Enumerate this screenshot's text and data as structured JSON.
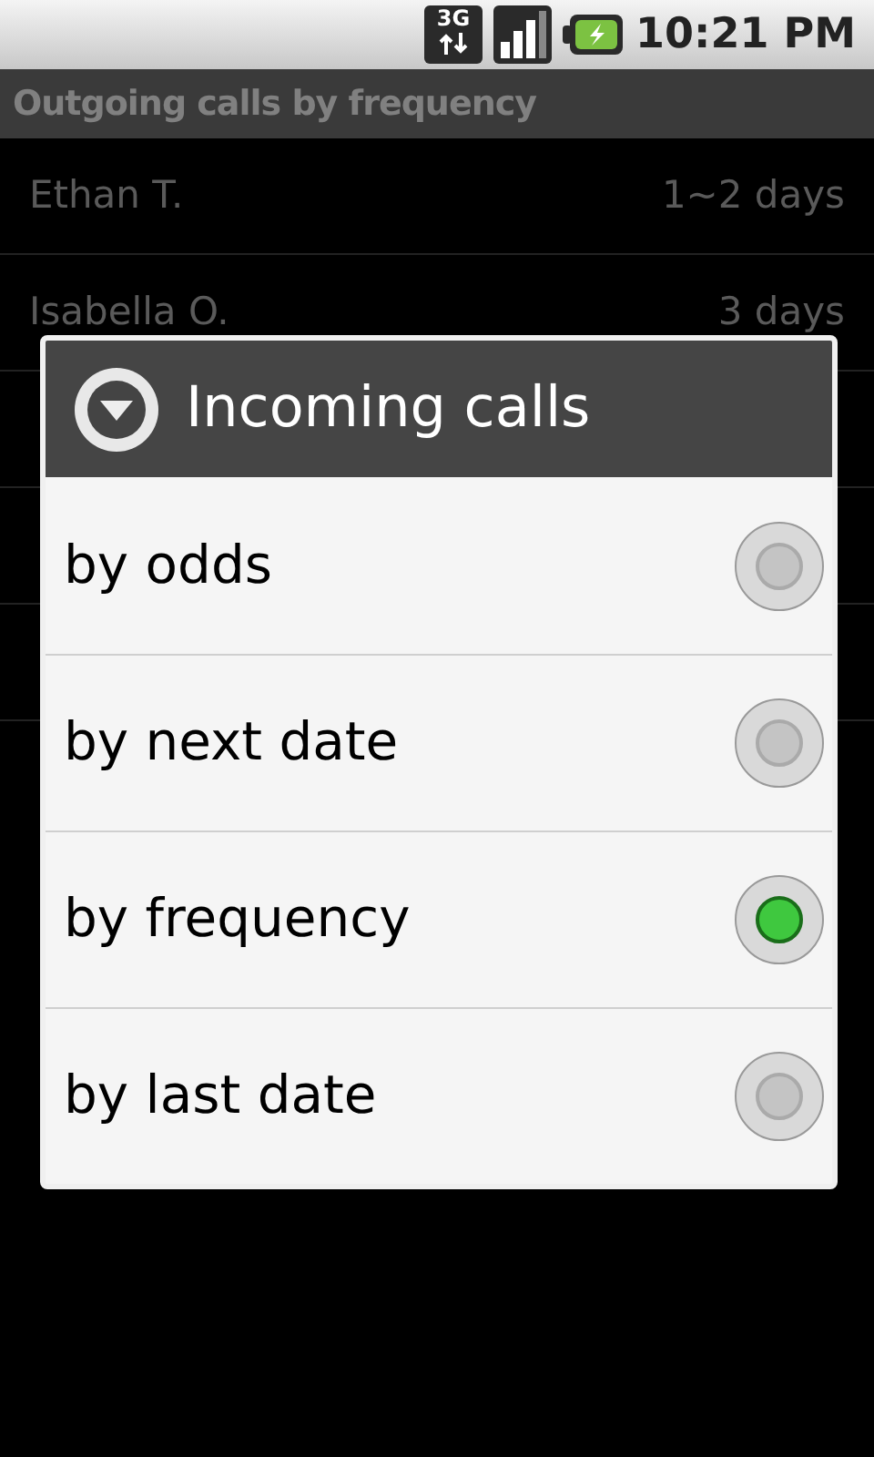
{
  "status_bar": {
    "time": "10:21 PM",
    "network": "3G"
  },
  "title": "Outgoing calls by frequency",
  "contacts": [
    {
      "name": "Ethan T.",
      "interval": "1~2 days"
    },
    {
      "name": "Isabella O.",
      "interval": "3 days"
    }
  ],
  "dialog": {
    "title": "Incoming calls",
    "options": [
      {
        "label": "by odds",
        "selected": false
      },
      {
        "label": "by next date",
        "selected": false
      },
      {
        "label": "by frequency",
        "selected": true
      },
      {
        "label": "by last date",
        "selected": false
      }
    ]
  }
}
